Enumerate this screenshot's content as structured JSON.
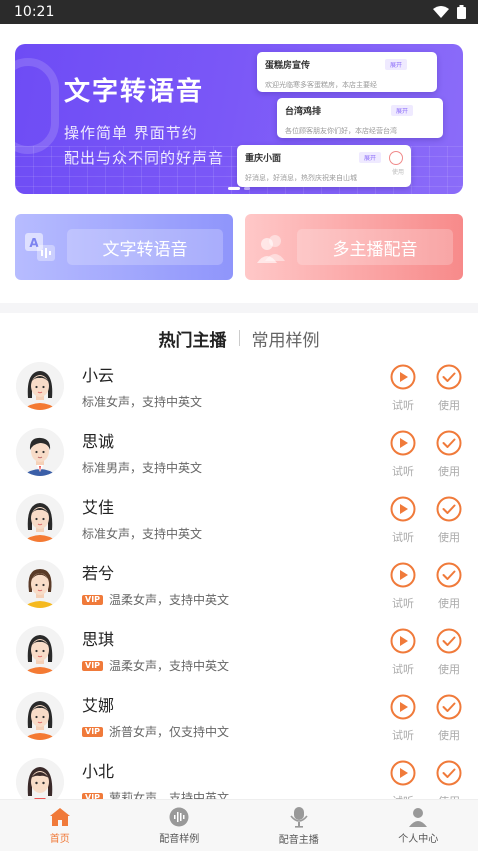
{
  "status_bar": {
    "time": "10:21"
  },
  "banner": {
    "title": "文字转语音",
    "subtitle_1": "操作简单 界面节约",
    "subtitle_2": "配出与众不同的好声音",
    "cards": [
      {
        "title": "蛋糕房宣传",
        "body": "欢迎光临寒多客蛋糕房，本店主要经",
        "tag": "展开"
      },
      {
        "title": "台湾鸡排",
        "body": "各位顾客朋友你们好，本店经营台湾",
        "tag": "展开"
      },
      {
        "title": "重庆小面",
        "body": "好消息，好消息，热烈庆祝来自山城",
        "tag": "展开",
        "use_label": "使用"
      }
    ]
  },
  "quick_actions": [
    {
      "label": "文字转语音",
      "icon": "text-to-speech-icon",
      "color_start": "#b7bcff",
      "color_end": "#8f95fb"
    },
    {
      "label": "多主播配音",
      "icon": "multi-anchor-icon",
      "color_start": "#ffc8c8",
      "color_end": "#f78a8a"
    }
  ],
  "tabs": [
    {
      "label": "热门主播",
      "active": true
    },
    {
      "label": "常用样例",
      "active": false
    }
  ],
  "actions": {
    "listen_label": "试听",
    "use_label": "使用"
  },
  "anchors": [
    {
      "name": "小云",
      "desc": "标准女声，支持中英文",
      "vip": false,
      "avatar": "female-avatar"
    },
    {
      "name": "思诚",
      "desc": "标准男声，支持中英文",
      "vip": false,
      "avatar": "male-avatar"
    },
    {
      "name": "艾佳",
      "desc": "标准女声，支持中英文",
      "vip": false,
      "avatar": "female-avatar"
    },
    {
      "name": "若兮",
      "desc": "温柔女声，支持中英文",
      "vip": true,
      "avatar": "female-avatar"
    },
    {
      "name": "思琪",
      "desc": "温柔女声，支持中英文",
      "vip": true,
      "avatar": "female-avatar"
    },
    {
      "name": "艾娜",
      "desc": "浙普女声，仅支持中文",
      "vip": true,
      "avatar": "female-avatar"
    },
    {
      "name": "小北",
      "desc": "萝莉女声，支持中英文",
      "vip": true,
      "avatar": "girl-avatar"
    }
  ],
  "vip_label": "VIP",
  "bottom_nav": [
    {
      "label": "首页",
      "icon": "home-icon",
      "active": true
    },
    {
      "label": "配音样例",
      "icon": "sound-wave-icon",
      "active": false
    },
    {
      "label": "配音主播",
      "icon": "microphone-icon",
      "active": false
    },
    {
      "label": "个人中心",
      "icon": "person-icon",
      "active": false
    }
  ],
  "colors": {
    "accent": "#f07a3a",
    "banner": "#6e4cf5"
  }
}
